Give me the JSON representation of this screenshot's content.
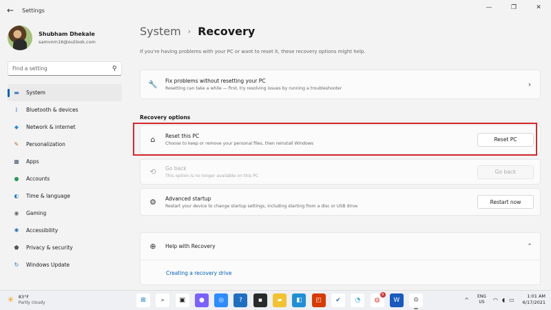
{
  "window": {
    "title": "Settings",
    "back_glyph": "←",
    "minimize_glyph": "—",
    "maximize_glyph": "❐",
    "close_glyph": "✕"
  },
  "profile": {
    "name": "Shubham Dhekale",
    "email": "samvnm16@outlook.com"
  },
  "search": {
    "placeholder": "Find a setting",
    "icon": "search-icon"
  },
  "sidebar": {
    "items": [
      {
        "label": "System",
        "icon": "system-icon",
        "glyph": "▬",
        "color": "#3b76c9",
        "active": true
      },
      {
        "label": "Bluetooth & devices",
        "icon": "bluetooth-icon",
        "glyph": "ᛒ",
        "color": "#1a73c9"
      },
      {
        "label": "Network & internet",
        "icon": "wifi-icon",
        "glyph": "◆",
        "color": "#2a8be0"
      },
      {
        "label": "Personalization",
        "icon": "brush-icon",
        "glyph": "✎",
        "color": "#b06a2c"
      },
      {
        "label": "Apps",
        "icon": "apps-icon",
        "glyph": "▦",
        "color": "#4a5a6a"
      },
      {
        "label": "Accounts",
        "icon": "accounts-icon",
        "glyph": "●",
        "color": "#2c9c5a"
      },
      {
        "label": "Time & language",
        "icon": "globe-icon",
        "glyph": "◐",
        "color": "#1f7ac4"
      },
      {
        "label": "Gaming",
        "icon": "gaming-icon",
        "glyph": "◉",
        "color": "#6b6b6b"
      },
      {
        "label": "Accessibility",
        "icon": "accessibility-icon",
        "glyph": "✱",
        "color": "#1f6fc0"
      },
      {
        "label": "Privacy & security",
        "icon": "shield-icon",
        "glyph": "⬟",
        "color": "#555555"
      },
      {
        "label": "Windows Update",
        "icon": "update-icon",
        "glyph": "↻",
        "color": "#1f6fc0"
      }
    ]
  },
  "breadcrumb": {
    "parent": "System",
    "separator": "›",
    "current": "Recovery"
  },
  "intro": "If you're having problems with your PC or want to reset it, these recovery options might help.",
  "fix_card": {
    "title": "Fix problems without resetting your PC",
    "description": "Resetting can take a while — first, try resolving issues by running a troubleshooter",
    "icon": "wrench-icon",
    "glyph": "🔧",
    "chevron": "›"
  },
  "section_title": "Recovery options",
  "options": [
    {
      "title": "Reset this PC",
      "description": "Choose to keep or remove your personal files, then reinstall Windows",
      "button": "Reset PC",
      "icon": "reset-pc-icon",
      "glyph": "⌂",
      "disabled": false
    },
    {
      "title": "Go back",
      "description": "This option is no longer available on this PC",
      "button": "Go back",
      "icon": "history-icon",
      "glyph": "⟲",
      "disabled": true
    },
    {
      "title": "Advanced startup",
      "description": "Restart your device to change startup settings, including starting from a disc or USB drive",
      "button": "Restart now",
      "icon": "advanced-startup-icon",
      "glyph": "⚙",
      "disabled": false
    }
  ],
  "help": {
    "title": "Help with Recovery",
    "link": "Creating a recovery drive",
    "icon": "globe-icon",
    "glyph": "⊕",
    "chevron": "⌃"
  },
  "taskbar": {
    "weather": {
      "temp": "83°F",
      "desc": "Partly cloudy",
      "icon": "partly-cloudy-icon",
      "glyph": "☀"
    },
    "apps": [
      {
        "name": "start-icon",
        "glyph": "⊞",
        "bg": "#ffffff",
        "fg": "#0078d4"
      },
      {
        "name": "search-icon",
        "glyph": "⌕",
        "bg": "#ffffff",
        "fg": "#1a1a1a"
      },
      {
        "name": "task-view-icon",
        "glyph": "▣",
        "bg": "#ffffff",
        "fg": "#1a1a1a"
      },
      {
        "name": "chat-icon",
        "glyph": "●",
        "bg": "#7b61ff",
        "fg": "#ffffff"
      },
      {
        "name": "zoom-icon",
        "glyph": "◎",
        "bg": "#2d8cff",
        "fg": "#ffffff"
      },
      {
        "name": "help-icon",
        "glyph": "?",
        "bg": "#1f6fc0",
        "fg": "#ffffff"
      },
      {
        "name": "terminal-icon",
        "glyph": "▪",
        "bg": "#2b2b2b",
        "fg": "#ffffff"
      },
      {
        "name": "file-explorer-icon",
        "glyph": "▰",
        "bg": "#f2c230",
        "fg": "#ffffff"
      },
      {
        "name": "store-icon",
        "glyph": "◧",
        "bg": "#1f8fd6",
        "fg": "#ffffff"
      },
      {
        "name": "office-icon",
        "glyph": "◰",
        "bg": "#d83b01",
        "fg": "#ffffff"
      },
      {
        "name": "todo-icon",
        "glyph": "✔",
        "bg": "#ffffff",
        "fg": "#2564cf"
      },
      {
        "name": "edge-icon",
        "glyph": "◔",
        "bg": "#ffffff",
        "fg": "#1c9fd3"
      },
      {
        "name": "chrome-icon",
        "glyph": "◍",
        "bg": "#ffffff",
        "fg": "#de3a2f",
        "badge": "9"
      },
      {
        "name": "word-icon",
        "glyph": "W",
        "bg": "#185abd",
        "fg": "#ffffff"
      },
      {
        "name": "settings-icon",
        "glyph": "⚙",
        "bg": "#ffffff",
        "fg": "#6b6b6b",
        "active": true
      }
    ],
    "tray": {
      "chevron": "^",
      "lang": "ENG",
      "region": "US",
      "wifi_glyph": "◠",
      "volume_glyph": "◖",
      "battery_glyph": "▭",
      "time": "1:01 AM",
      "date": "6/17/2021"
    }
  }
}
